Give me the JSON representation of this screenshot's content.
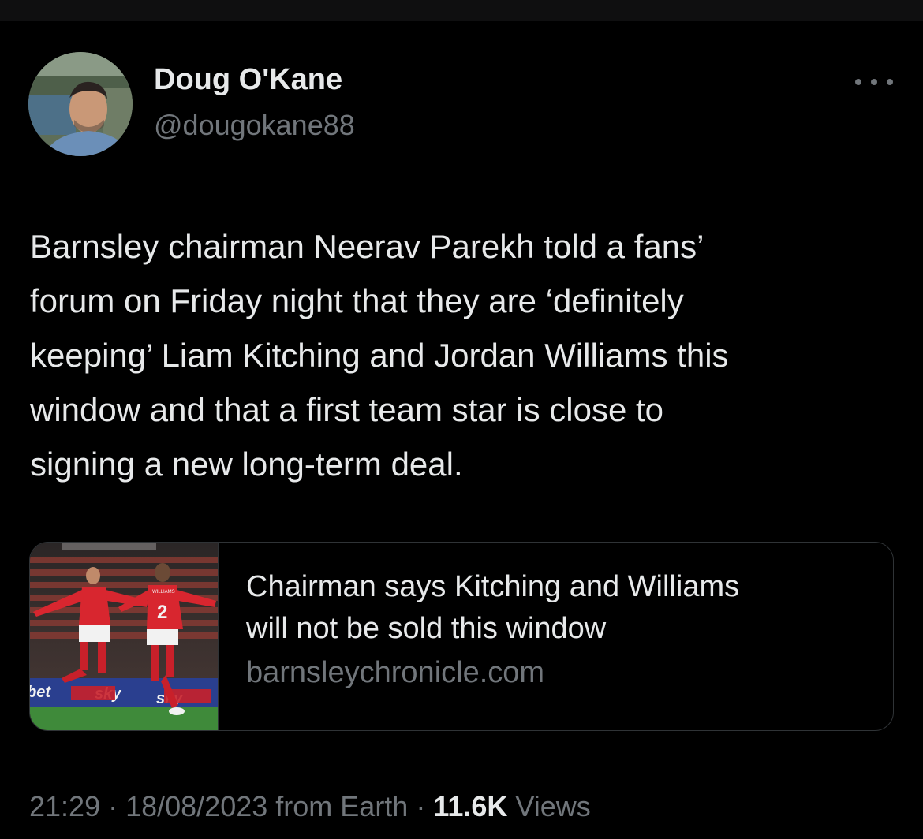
{
  "author": {
    "name": "Doug O'Kane",
    "handle": "@dougokane88"
  },
  "tweet": {
    "text_lines": [
      "Barnsley chairman Neerav Parekh told a fans’",
      "forum on Friday night that they are ‘definitely",
      "keeping’ Liam Kitching and Jordan Williams this",
      "window and that a first team star is close to",
      "signing a new long-term deal."
    ]
  },
  "link_card": {
    "title_lines": [
      "Chairman says Kitching and Williams",
      "will not be sold this window"
    ],
    "domain": "barnsleychronicle.com",
    "thumbnail": {
      "shirt_number": "2",
      "shirt_name": "WILLIAMS",
      "board_text": "bet"
    }
  },
  "meta": {
    "time": "21:29",
    "separator": " · ",
    "date": "18/08/2023",
    "source": " from Earth",
    "views_count": "11.6K",
    "views_label": " Views"
  },
  "icons": {
    "more": "more-horizontal-icon"
  },
  "colors": {
    "background": "#000000",
    "primary_text": "#e7e9ea",
    "secondary_text": "#71767b",
    "border": "#2f3336",
    "kit_red": "#d8262f"
  }
}
